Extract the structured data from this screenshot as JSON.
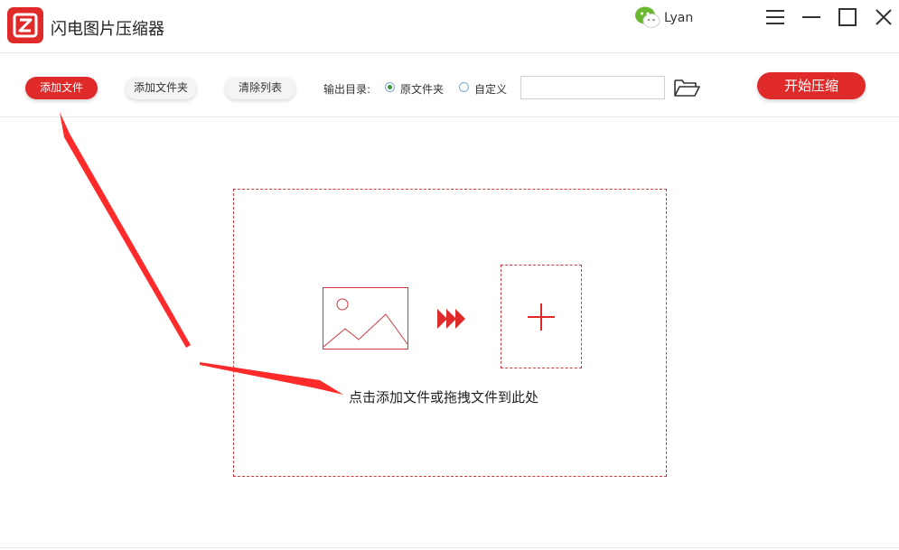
{
  "app": {
    "title": "闪电图片压缩器",
    "user_name": "Lyan"
  },
  "toolbar": {
    "add_file": "添加文件",
    "add_folder": "添加文件夹",
    "clear_list": "清除列表",
    "output_label": "输出目录:",
    "option_original": "原文件夹",
    "option_custom": "自定义",
    "selected_option": "original",
    "path_value": "",
    "start": "开始压缩"
  },
  "dropzone": {
    "hint": "点击添加文件或拖拽文件到此处"
  },
  "colors": {
    "accent": "#e02a2a",
    "dashed_border": "#d0393e",
    "radio_dot": "#2e9a37",
    "wechat": "#6ab82f"
  },
  "icons": {
    "logo": "app-logo-icon",
    "user": "wechat-icon",
    "menu": "menu-icon",
    "minimize": "minimize-icon",
    "maximize": "maximize-icon",
    "close": "close-icon",
    "folder": "folder-open-icon",
    "image": "image-icon",
    "arrows": "triple-arrow-icon",
    "plus": "plus-icon"
  }
}
